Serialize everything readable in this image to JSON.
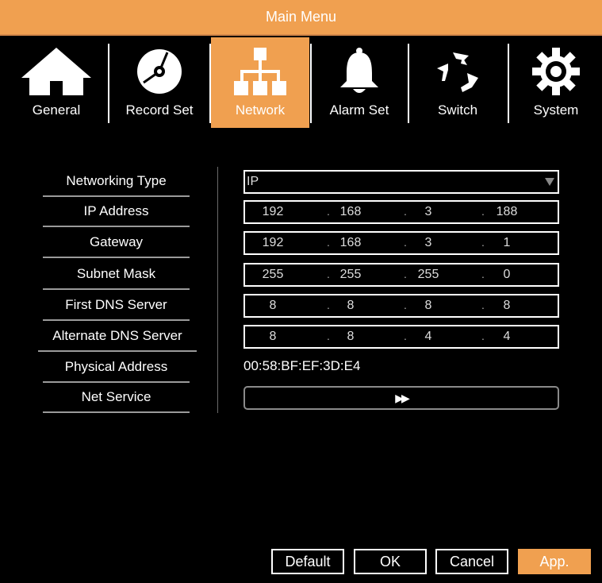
{
  "window": {
    "title": "Main Menu"
  },
  "tabs": [
    {
      "label": "General",
      "icon": "home-icon"
    },
    {
      "label": "Record Set",
      "icon": "disc-icon"
    },
    {
      "label": "Network",
      "icon": "network-icon",
      "active": true
    },
    {
      "label": "Alarm Set",
      "icon": "bell-icon"
    },
    {
      "label": "Switch",
      "icon": "switch-arrows-icon"
    },
    {
      "label": "System",
      "icon": "gear-icon"
    }
  ],
  "form": {
    "networking_type": {
      "label": "Networking Type",
      "value": "IP"
    },
    "ip_address": {
      "label": "IP Address",
      "octets": [
        "192",
        "168",
        "3",
        "188"
      ]
    },
    "gateway": {
      "label": "Gateway",
      "octets": [
        "192",
        "168",
        "3",
        "1"
      ]
    },
    "subnet_mask": {
      "label": "Subnet Mask",
      "octets": [
        "255",
        "255",
        "255",
        "0"
      ]
    },
    "first_dns": {
      "label": "First DNS Server",
      "octets": [
        "8",
        "8",
        "8",
        "8"
      ]
    },
    "alternate_dns": {
      "label": "Alternate DNS Server",
      "octets": [
        "8",
        "8",
        "4",
        "4"
      ]
    },
    "physical_address": {
      "label": "Physical Address",
      "value": "00:58:BF:EF:3D:E4"
    },
    "net_service": {
      "label": "Net Service",
      "button": "▶▶"
    },
    "dot": "."
  },
  "footer": {
    "default_label": "Default",
    "ok_label": "OK",
    "cancel_label": "Cancel",
    "apply_label": "App."
  },
  "colors": {
    "accent": "#f0a050",
    "background": "#000000"
  }
}
